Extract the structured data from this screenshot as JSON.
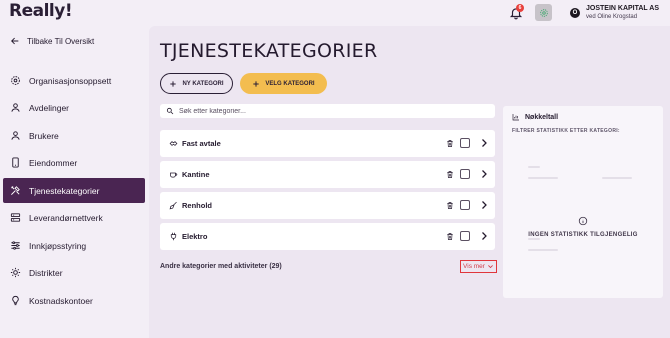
{
  "brand": {
    "logo": "Really!"
  },
  "header": {
    "notification_count": "6",
    "company_name": "JOSTEIN KAPITAL AS",
    "company_subtitle": "ved Oline Krogstad",
    "company_initial": "O"
  },
  "sidebar": {
    "back_label": "Tilbake Til Oversikt",
    "items": [
      {
        "label": "Organisasjonsoppsett",
        "icon": "gear-icon"
      },
      {
        "label": "Avdelinger",
        "icon": "person-icon"
      },
      {
        "label": "Brukere",
        "icon": "person-icon"
      },
      {
        "label": "Eiendommer",
        "icon": "phone-icon"
      },
      {
        "label": "Tjenestekategorier",
        "icon": "tools-icon",
        "active": true
      },
      {
        "label": "Leverandørnettverk",
        "icon": "network-icon"
      },
      {
        "label": "Innkjøpsstyring",
        "icon": "sliders-icon"
      },
      {
        "label": "Distrikter",
        "icon": "sun-icon"
      },
      {
        "label": "Kostnadskontoer",
        "icon": "bulb-icon"
      }
    ]
  },
  "main": {
    "title": "TJENESTEKATEGORIER",
    "new_category_label": "NY KATEGORI",
    "choose_category_label": "VELG KATEGORI",
    "search_placeholder": "Søk etter kategorier...",
    "categories": [
      {
        "label": "Fast avtale",
        "icon": "handshake-icon"
      },
      {
        "label": "Kantine",
        "icon": "coffee-icon"
      },
      {
        "label": "Renhold",
        "icon": "broom-icon"
      },
      {
        "label": "Elektro",
        "icon": "plug-icon"
      }
    ],
    "more_categories_label": "Andre kategorier med aktiviteter (29)",
    "show_more_label": "Vis mer"
  },
  "stats": {
    "title": "Nøkkeltall",
    "filter_label": "FILTRER STATISTIKK ETTER KATEGORI:",
    "empty_label": "INGEN STATISTIKK TILGJENGELIG"
  },
  "colors": {
    "sidebar_active": "#4a2552",
    "accent_yellow": "#f3bd4f",
    "badge_red": "#e8403c",
    "highlight_red": "#e0363c"
  }
}
